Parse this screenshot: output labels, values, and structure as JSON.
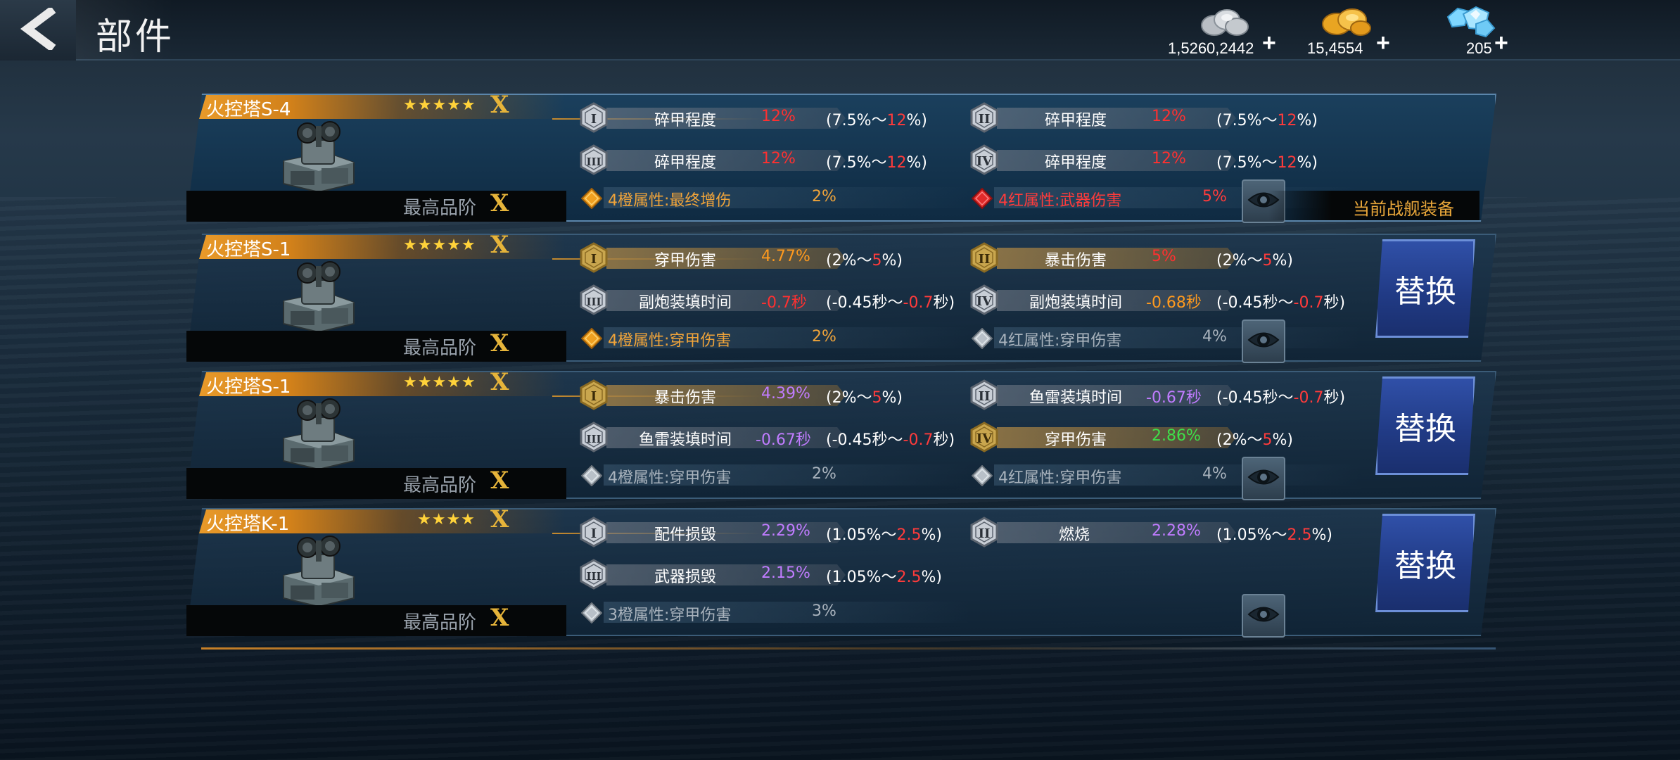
{
  "header": {
    "title": "部件",
    "currencies": [
      {
        "name": "silver-coin",
        "amount": "1,5260,2442"
      },
      {
        "name": "gold-coin",
        "amount": "15,4554"
      },
      {
        "name": "diamond",
        "amount": "205"
      }
    ],
    "plus": "+"
  },
  "common": {
    "grade_label": "最高品阶",
    "x_mark": "X",
    "swap_label": "替换",
    "equipped_label": "当前战舰装备"
  },
  "cards": [
    {
      "name": "火控塔S-4",
      "stars": "★★★★★",
      "stars_count": 5,
      "selected": true,
      "stats": [
        {
          "numeral": "I",
          "label": "碎甲程度",
          "value": "12%",
          "range_prefix": "(7.5%～",
          "range_hi": "12",
          "range_suffix": "%)",
          "highlight": false
        },
        {
          "numeral": "II",
          "label": "碎甲程度",
          "value": "12%",
          "range_prefix": "(7.5%～",
          "range_hi": "12",
          "range_suffix": "%)",
          "highlight": false
        },
        {
          "numeral": "III",
          "label": "碎甲程度",
          "value": "12%",
          "range_prefix": "(7.5%～",
          "range_hi": "12",
          "range_suffix": "%)",
          "highlight": false
        },
        {
          "numeral": "IV",
          "label": "碎甲程度",
          "value": "12%",
          "range_prefix": "(7.5%～",
          "range_hi": "12",
          "range_suffix": "%)",
          "highlight": false
        }
      ],
      "bonuses": [
        {
          "gem": "orange-gem",
          "label": "4橙属性:最终增伤",
          "value": "2%"
        },
        {
          "gem": "red-gem",
          "label": "4红属性:武器伤害",
          "value": "5%"
        }
      ]
    },
    {
      "name": "火控塔S-1",
      "stars": "★★★★★",
      "stars_count": 5,
      "selected": false,
      "stats": [
        {
          "numeral": "I",
          "label": "穿甲伤害",
          "value": "4.77%",
          "range_prefix": "(2%～",
          "range_hi": "5",
          "range_suffix": "%)",
          "highlight": true
        },
        {
          "numeral": "II",
          "label": "暴击伤害",
          "value": "5%",
          "range_prefix": "(2%～",
          "range_hi": "5",
          "range_suffix": "%)",
          "highlight": true
        },
        {
          "numeral": "III",
          "label": "副炮装填时间",
          "value": "-0.7秒",
          "range_prefix": "(-0.45秒～",
          "range_hi": "-0.7",
          "range_suffix": "秒)",
          "highlight": false
        },
        {
          "numeral": "IV",
          "label": "副炮装填时间",
          "value": "-0.68秒",
          "range_prefix": "(-0.45秒～",
          "range_hi": "-0.7",
          "range_suffix": "秒)",
          "highlight": false
        }
      ],
      "bonuses": [
        {
          "gem": "orange-gem",
          "label": "4橙属性:穿甲伤害",
          "value": "2%"
        },
        {
          "gem": "grey-gem",
          "label": "4红属性:穿甲伤害",
          "value": "4%"
        }
      ]
    },
    {
      "name": "火控塔S-1",
      "stars": "★★★★★",
      "stars_count": 5,
      "selected": false,
      "stats": [
        {
          "numeral": "I",
          "label": "暴击伤害",
          "value": "4.39%",
          "range_prefix": "(2%～",
          "range_hi": "5",
          "range_suffix": "%)",
          "highlight": true
        },
        {
          "numeral": "II",
          "label": "鱼雷装填时间",
          "value": "-0.67秒",
          "range_prefix": "(-0.45秒～",
          "range_hi": "-0.7",
          "range_suffix": "秒)",
          "highlight": false
        },
        {
          "numeral": "III",
          "label": "鱼雷装填时间",
          "value": "-0.67秒",
          "range_prefix": "(-0.45秒～",
          "range_hi": "-0.7",
          "range_suffix": "秒)",
          "highlight": false
        },
        {
          "numeral": "IV",
          "label": "穿甲伤害",
          "value": "2.86%",
          "range_prefix": "(2%～",
          "range_hi": "5",
          "range_suffix": "%)",
          "highlight": true
        }
      ],
      "bonuses": [
        {
          "gem": "grey-gem",
          "label": "4橙属性:穿甲伤害",
          "value": "2%"
        },
        {
          "gem": "grey-gem",
          "label": "4红属性:穿甲伤害",
          "value": "4%"
        }
      ]
    },
    {
      "name": "火控塔K-1",
      "stars": "★★★★",
      "stars_count": 4,
      "selected": false,
      "stats": [
        {
          "numeral": "I",
          "label": "配件损毁",
          "value": "2.29%",
          "range_prefix": "(1.05%～",
          "range_hi": "2.5",
          "range_suffix": "%)",
          "highlight": false
        },
        {
          "numeral": "II",
          "label": "燃烧",
          "value": "2.28%",
          "range_prefix": "(1.05%～",
          "range_hi": "2.5",
          "range_suffix": "%)",
          "highlight": false
        },
        {
          "numeral": "III",
          "label": "武器损毁",
          "value": "2.15%",
          "range_prefix": "(1.05%～",
          "range_hi": "2.5",
          "range_suffix": "%)",
          "highlight": false
        }
      ],
      "bonuses": [
        {
          "gem": "grey-gem",
          "label": "3橙属性:穿甲伤害",
          "value": "3%"
        }
      ]
    }
  ],
  "colors": {
    "red": "#ff3030",
    "orange": "#ff9a1e",
    "purple": "#c07cff",
    "green": "#3ee04a",
    "gold": "#f0a43a",
    "swap_blue": "#2a469a"
  },
  "value_colors": [
    [
      "red",
      "red",
      "red",
      "red"
    ],
    [
      "orange",
      "red",
      "red",
      "orange"
    ],
    [
      "purple",
      "purple",
      "purple",
      "green"
    ],
    [
      "purple",
      "purple",
      "purple"
    ]
  ],
  "bonus_colors": [
    [
      "gold",
      "red2"
    ],
    [
      "gold",
      "grey"
    ],
    [
      "grey",
      "grey"
    ],
    [
      "grey"
    ]
  ]
}
